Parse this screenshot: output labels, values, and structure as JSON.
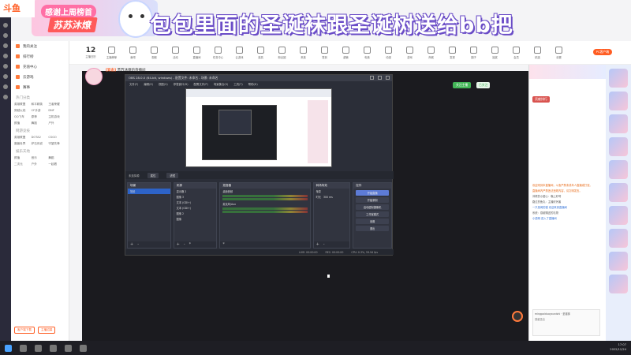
{
  "overlay": {
    "title": "包包里面的圣诞袜跟圣诞树送给bb把",
    "thanks": "感谢上周榜首",
    "streamer_badge": "苏苏沐燎"
  },
  "logo": {
    "text": "斗鱼"
  },
  "sitenav": {
    "items": [
      {
        "label": "我的关注"
      },
      {
        "label": "排行榜"
      },
      {
        "label": "充值中心"
      },
      {
        "label": "云游戏"
      },
      {
        "label": "赛事"
      }
    ],
    "sections": [
      {
        "title": "热门分类",
        "items": [
          "英雄联盟",
          "和平精英",
          "王者荣耀",
          "穿越火线",
          "CF手游",
          "DNF",
          "QQ飞车",
          "原神",
          "主机游戏",
          "颜值",
          "舞蹈",
          "户外"
        ]
      },
      {
        "title": "网游竞技",
        "items": [
          "英雄联盟",
          "DOTA2",
          "CSGO",
          "魔兽世界",
          "炉石传说",
          "守望先锋"
        ]
      },
      {
        "title": "娱乐天地",
        "items": [
          "颜值",
          "音乐",
          "舞蹈",
          "二次元",
          "户外",
          "一起看"
        ]
      }
    ],
    "bottom_buttons": [
      "客户端下载",
      "主播招募"
    ]
  },
  "catbar": {
    "day_number": "12",
    "day_label": "主播日历",
    "categories": [
      "主播榜单",
      "鱼吧",
      "视频",
      "活动",
      "直播间",
      "任务中心",
      "云游戏",
      "道具",
      "粉丝团",
      "贵族",
      "签到",
      "超管",
      "电竞",
      "动漫",
      "游戏",
      "商城",
      "发现",
      "圈子",
      "抽奖",
      "会员",
      "精选",
      "设置"
    ],
    "pc_button": "PC客户端"
  },
  "streamhead": {
    "tag_prefix": "[双击]",
    "tag_text": "苏苏沐燎的直播间",
    "follow_label": "关注主播",
    "follow2_label": "已关注"
  },
  "obs": {
    "title": "OBS 28.0.0 (64-bit, windows) - 配置文件: 未命名 - 场景: 未命名",
    "menu": [
      "文件(F)",
      "编辑(E)",
      "视图(V)",
      "停靠窗口(D)",
      "配置文件(P)",
      "场景集合(S)",
      "工具(T)",
      "帮助(H)"
    ],
    "toolbar": {
      "label": "未选择源",
      "props": "属性",
      "filters": "滤镜"
    },
    "docks": {
      "scenes": {
        "title": "场景",
        "items": [
          "场景"
        ]
      },
      "sources": {
        "title": "来源",
        "items": [
          "显示器 2",
          "图像 3",
          "文本 (GDI+)",
          "文本 (GDI+)",
          "图像 2",
          "图像"
        ]
      },
      "mixer": {
        "title": "混音器",
        "channels": [
          "桌面音频",
          "麦克风/Aux"
        ]
      },
      "transitions": {
        "title": "转场特效",
        "type": "渐变",
        "duration_label": "时长",
        "duration": "300 ms"
      },
      "controls": {
        "title": "控件",
        "buttons": [
          "开始直播",
          "开始录制",
          "启动虚拟摄像机",
          "工作室模式",
          "设置",
          "退出"
        ]
      }
    },
    "status": {
      "live": "LIVE: 00:00:00",
      "rec": "REC: 00:00:00",
      "cpu": "CPU: 0.3%, 59.94 fps"
    }
  },
  "chat": {
    "tab_label": "贡献排行",
    "messages": [
      {
        "text": "欢迎来到本直播间，斗鱼严禁未成年人直播或打赏。",
        "tone": "orange"
      },
      {
        "text": "直播间内严禁违法违规内容，请文明发言。",
        "tone": "orange"
      },
      {
        "text": "沐燎的小甜心：晚上好呀",
        "tone": "plain"
      },
      {
        "text": "路过的鱼丸：主播好厉害",
        "tone": "plain"
      },
      {
        "text": "一只悠闲的猫 欢迎来到直播间",
        "tone": "blue"
      },
      {
        "text": "系统：感谢赠送的礼物",
        "tone": "plain"
      },
      {
        "text": "小透明 进入了直播间",
        "tone": "blue"
      }
    ],
    "input_user": "mingpaiduoyounishi · 圣诞袜",
    "input_text": "感谢送出"
  },
  "taskbar": {
    "time": "17:07",
    "date": "2022/12/24"
  }
}
